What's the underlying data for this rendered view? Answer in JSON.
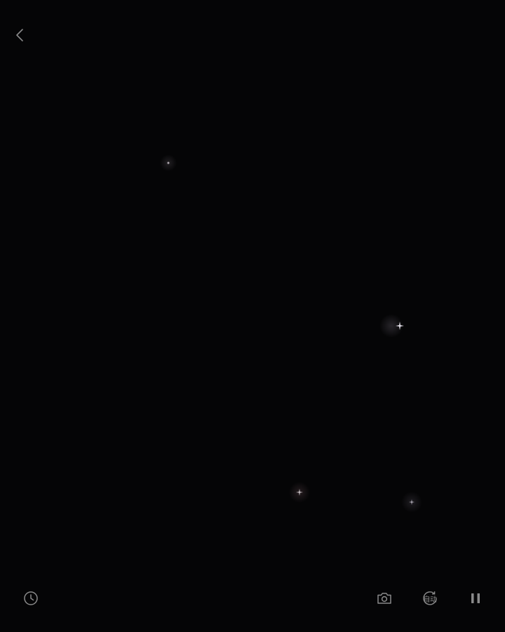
{
  "nav": {
    "back_icon": "chevron-left-icon"
  },
  "sky": {
    "stars": [
      "star-1",
      "star-2",
      "star-3",
      "star-4"
    ]
  },
  "toolbar": {
    "history_icon": "clock-icon",
    "camera_icon": "camera-icon",
    "auto_label": "自动",
    "auto_icon": "auto-rotate-icon",
    "pause_icon": "pause-icon"
  },
  "colors": {
    "background": "#050506",
    "icon": "#8a8a8a",
    "star": "#d8d8e0"
  }
}
